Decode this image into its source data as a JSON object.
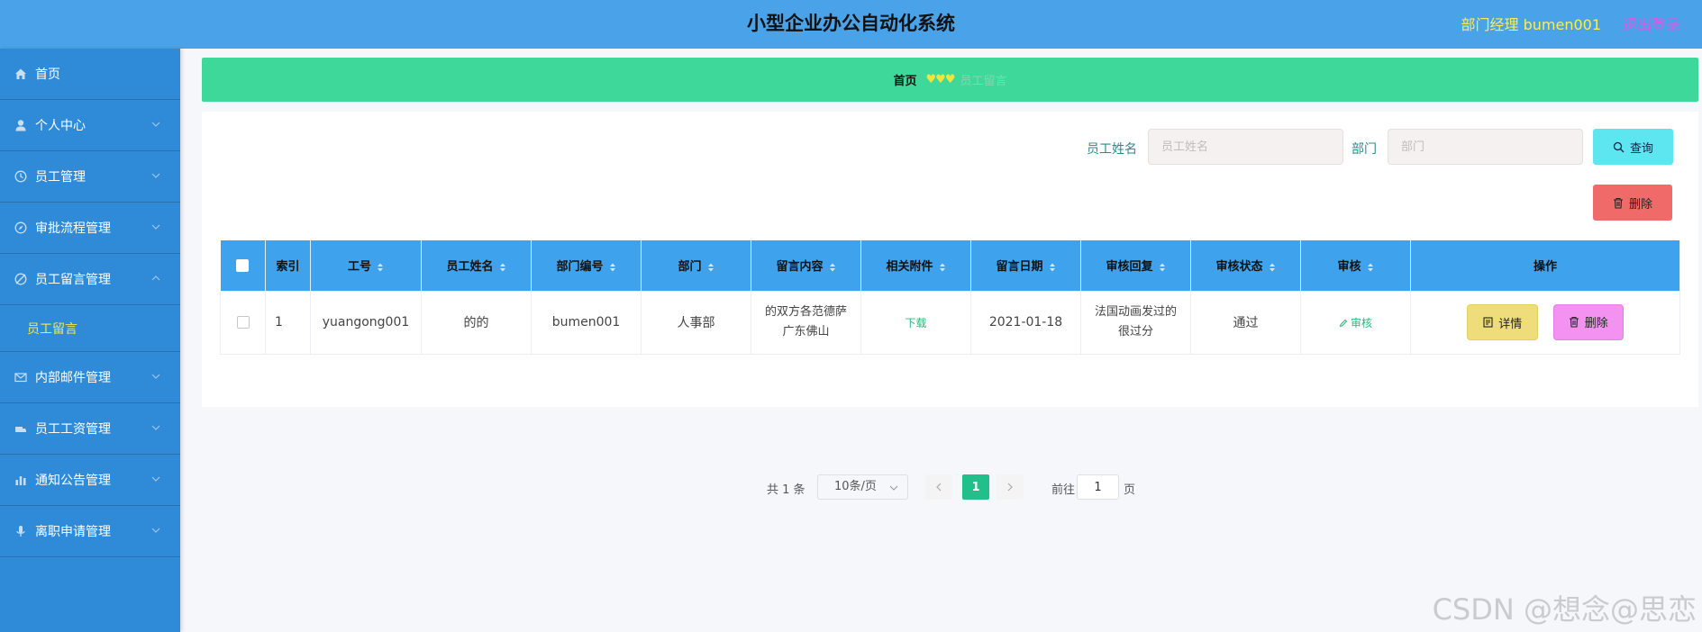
{
  "header": {
    "title": "小型企业办公自动化系统",
    "user_label": "部门经理 bumen001",
    "logout_label": "退出登录"
  },
  "sidebar": {
    "items": [
      {
        "label": "首页",
        "icon": "home-icon"
      },
      {
        "label": "个人中心",
        "icon": "user-icon"
      },
      {
        "label": "员工管理",
        "icon": "clock-icon"
      },
      {
        "label": "审批流程管理",
        "icon": "compass-icon"
      },
      {
        "label": "员工留言管理",
        "icon": "compass-off-icon"
      },
      {
        "label": "内部邮件管理",
        "icon": "mail-icon"
      },
      {
        "label": "员工工资管理",
        "icon": "truck-icon"
      },
      {
        "label": "通知公告管理",
        "icon": "bar-chart-icon"
      },
      {
        "label": "离职申请管理",
        "icon": "mic-icon"
      }
    ],
    "submenu": {
      "label": "员工留言"
    }
  },
  "breadcrumb": {
    "home": "首页",
    "separator": "♥♥♥",
    "current": "员工留言"
  },
  "search": {
    "name_label": "员工姓名",
    "name_placeholder": "员工姓名",
    "dept_label": "部门",
    "dept_placeholder": "部门",
    "query_label": "查询",
    "delete_label": "删除"
  },
  "table": {
    "headers": [
      "索引",
      "工号",
      "员工姓名",
      "部门编号",
      "部门",
      "留言内容",
      "相关附件",
      "留言日期",
      "审核回复",
      "审核状态",
      "审核",
      "操作"
    ],
    "rows": [
      {
        "index": "1",
        "employee_no": "yuangong001",
        "employee_name": "的的",
        "dept_no": "bumen001",
        "dept": "人事部",
        "content": "的双方各范德萨广东佛山",
        "attachment": "下载",
        "date": "2021-01-18",
        "reply": "法国动画发过的很过分",
        "status": "通过",
        "review": "审核",
        "detail_label": "详情",
        "delete_label": "删除"
      }
    ]
  },
  "pagination": {
    "total": "共 1 条",
    "page_size": "10条/页",
    "current_page": "1",
    "goto_label": "前往",
    "goto_value": "1",
    "page_suffix": "页"
  },
  "watermark": "CSDN @想念@思恋",
  "colors": {
    "header": "#4aa3e8",
    "sidebar": "#2f8bd8",
    "breadcrumb": "#3ed99a",
    "table_header": "#3fa2ec",
    "accent_green": "#21c08a"
  }
}
